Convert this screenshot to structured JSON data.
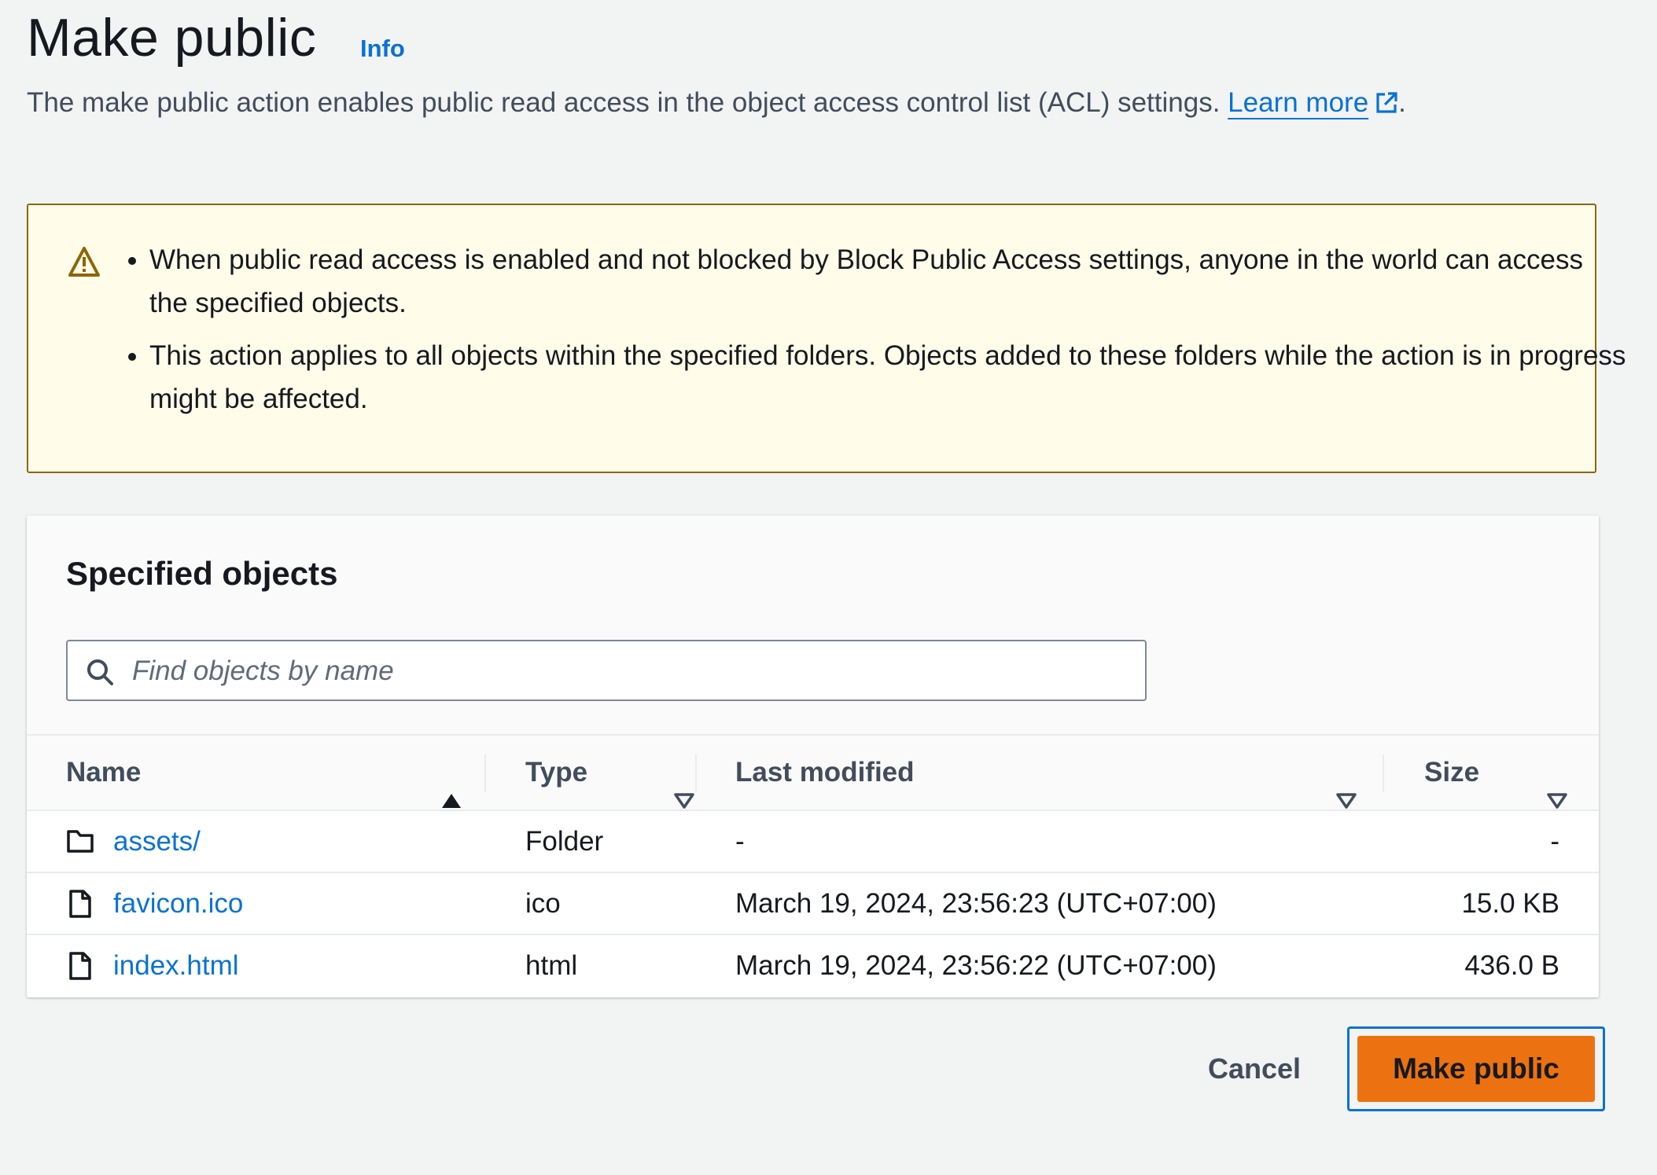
{
  "header": {
    "title": "Make public",
    "info_label": "Info",
    "description": "The make public action enables public read access in the object access control list (ACL) settings.",
    "learn_more_label": "Learn more",
    "trailing_period": "."
  },
  "alert": {
    "type": "warning",
    "icon": "warning-icon",
    "items": [
      "When public read access is enabled and not blocked by Block Public Access settings, anyone in the world can access the specified objects.",
      "This action applies to all objects within the specified folders. Objects added to these folders while the action is in progress might be affected."
    ]
  },
  "objects_panel": {
    "title": "Specified objects",
    "search": {
      "placeholder": "Find objects by name",
      "value": ""
    },
    "columns": {
      "name": "Name",
      "type": "Type",
      "last_modified": "Last modified",
      "size": "Size"
    },
    "sort": {
      "column": "Name",
      "direction": "ascending"
    },
    "rows": [
      {
        "icon": "folder-icon",
        "name": "assets/",
        "type": "Folder",
        "last_modified": "-",
        "size": "-"
      },
      {
        "icon": "file-icon",
        "name": "favicon.ico",
        "type": "ico",
        "last_modified": "March 19, 2024, 23:56:23 (UTC+07:00)",
        "size": "15.0 KB"
      },
      {
        "icon": "file-icon",
        "name": "index.html",
        "type": "html",
        "last_modified": "March 19, 2024, 23:56:22 (UTC+07:00)",
        "size": "436.0 B"
      }
    ]
  },
  "actions": {
    "cancel_label": "Cancel",
    "primary_label": "Make public"
  },
  "colors": {
    "link": "#0972d3",
    "primary_button": "#ec7211",
    "warning_border": "#8d6605",
    "warning_background": "#fffce9",
    "page_background": "#f2f3f3"
  }
}
